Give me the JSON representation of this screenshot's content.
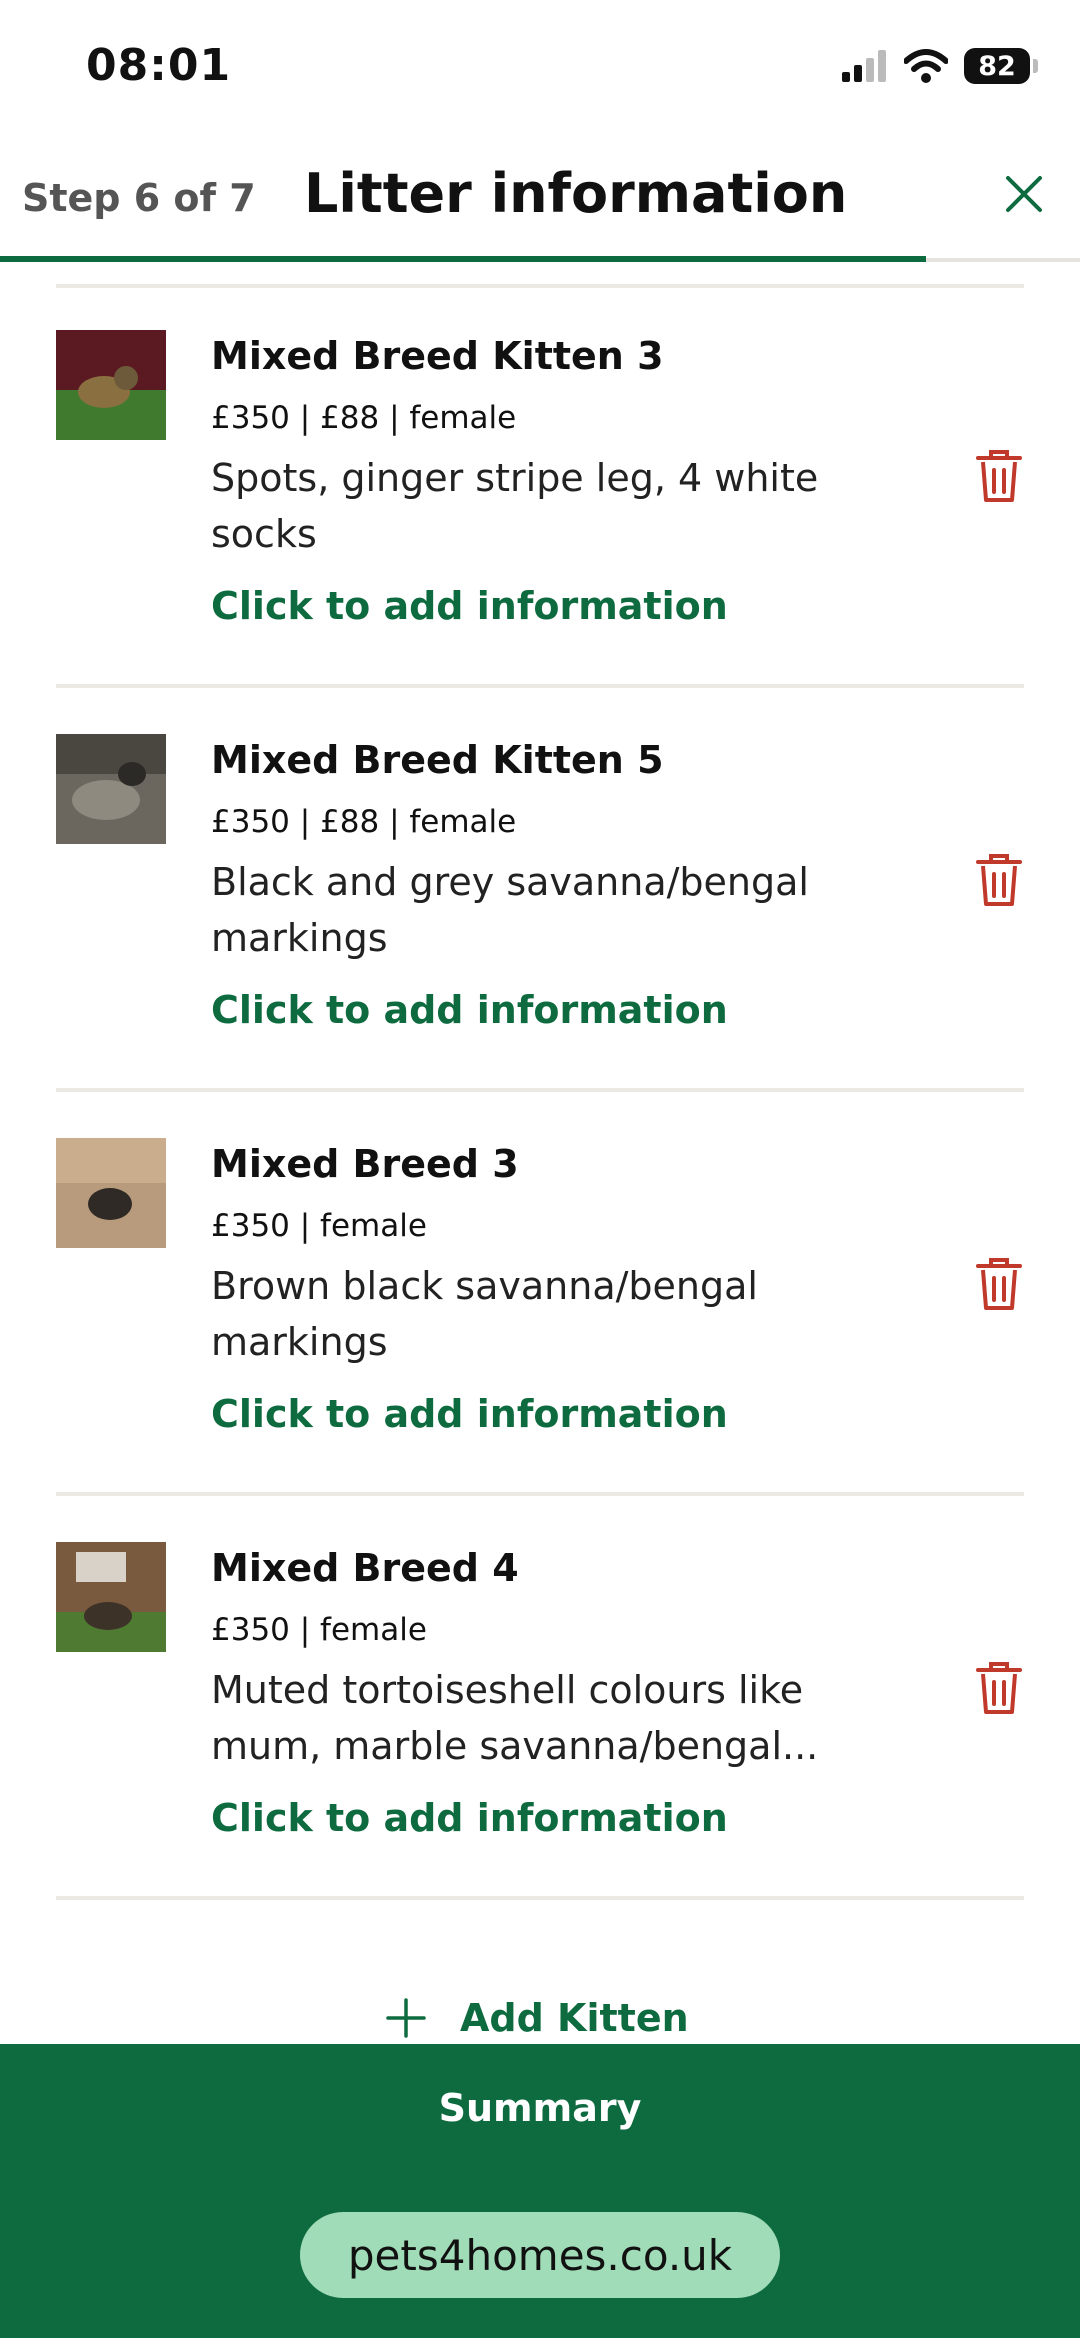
{
  "status": {
    "time": "08:01",
    "battery": "82"
  },
  "header": {
    "step": "Step 6 of 7",
    "title": "Litter information",
    "progress": 0.857
  },
  "kittens": [
    {
      "name": "Mixed Breed Kitten 3",
      "meta": "£350 | £88 | female",
      "description": "Spots, ginger stripe leg, 4 white socks",
      "link": "Click to add information"
    },
    {
      "name": "Mixed Breed Kitten 5",
      "meta": "£350 | £88 | female",
      "description": "Black and grey savanna/bengal markings",
      "link": "Click to add information"
    },
    {
      "name": "Mixed Breed 3",
      "meta": "£350 | female",
      "description": "Brown black savanna/bengal markings",
      "link": "Click to add information"
    },
    {
      "name": "Mixed Breed 4",
      "meta": "£350 | female",
      "description": "Muted tortoiseshell colours like mum, marble savanna/bengal...",
      "link": "Click to add information"
    }
  ],
  "actions": {
    "add_kitten": "Add Kitten",
    "summary": "Summary"
  },
  "browser": {
    "url": "pets4homes.co.uk"
  },
  "colors": {
    "brand_green": "#0e6b3f",
    "delete_red": "#c0392b",
    "pill_green": "#9fdcb7"
  }
}
